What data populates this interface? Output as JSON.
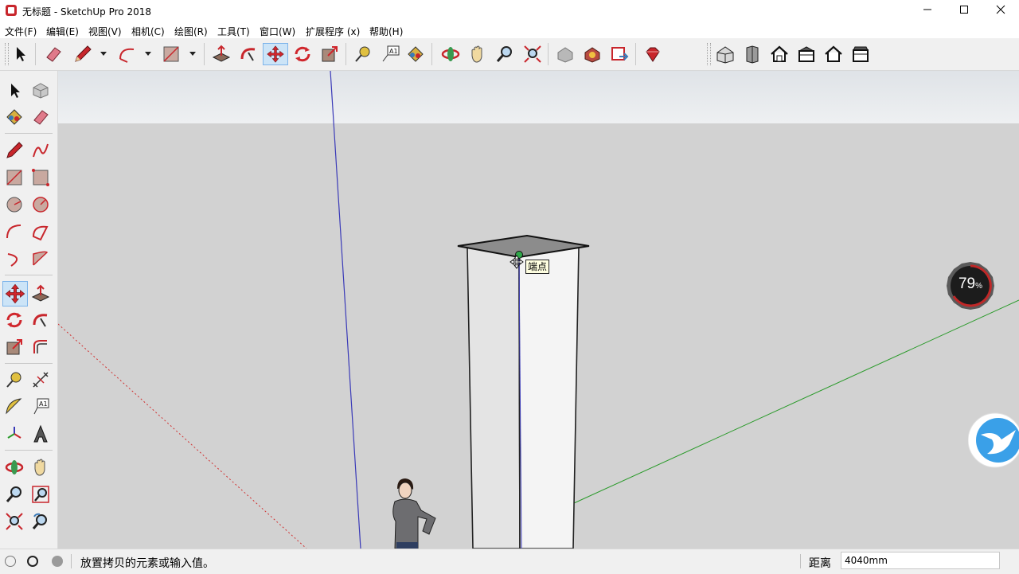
{
  "window": {
    "title": "无标题 - SketchUp Pro 2018",
    "controls": [
      "minimize-icon",
      "maximize-icon",
      "close-icon"
    ]
  },
  "menu": [
    "文件(F)",
    "编辑(E)",
    "视图(V)",
    "相机(C)",
    "绘图(R)",
    "工具(T)",
    "窗口(W)",
    "扩展程序 (x)",
    "帮助(H)"
  ],
  "toolbar": {
    "icons": [
      "select-icon",
      "eraser-icon",
      "pencil-icon",
      "arc-icon",
      "rectangle-icon",
      "push-pull-icon",
      "follow-me-icon",
      "move-icon",
      "rotate-icon",
      "scale-icon",
      "tape-measure-icon",
      "text-icon",
      "paint-bucket-icon",
      "orbit-icon",
      "pan-icon",
      "zoom-icon",
      "zoom-extents-icon",
      "warehouse-icon",
      "extension-warehouse-icon",
      "send-to-layout-icon",
      "ruby-console-icon",
      "iso-view-icon",
      "front-view-icon",
      "home-view-icon",
      "right-view-icon",
      "back-view-icon",
      "bottom-view-icon"
    ],
    "active": "move-icon"
  },
  "left_toolbar": {
    "icons": [
      "select-icon",
      "make-component-icon",
      "paint-bucket-icon",
      "eraser-icon",
      "pencil-icon",
      "freehand-icon",
      "rectangle-icon",
      "rotated-rectangle-icon",
      "circle-icon",
      "polygon-icon",
      "arc-icon",
      "pie-icon",
      "three-point-arc-icon",
      "two-point-arc-icon",
      "move-icon",
      "push-pull-icon",
      "rotate-icon",
      "follow-me-icon",
      "scale-icon",
      "offset-icon",
      "tape-measure-icon",
      "dimension-icon",
      "protractor-icon",
      "text-icon",
      "axes-icon",
      "3d-text-icon",
      "orbit-icon",
      "pan-icon",
      "zoom-icon",
      "zoom-window-icon",
      "zoom-extents-icon",
      "previous-view-icon"
    ],
    "active": "move-icon"
  },
  "viewport": {
    "tooltip": "端点",
    "gauge": {
      "value": "79",
      "unit": "%"
    }
  },
  "status": {
    "message": "放置拷贝的元素或输入值。",
    "measurement_label": "距离",
    "measurement_value": "4040mm"
  },
  "colors": {
    "viewport_bg": "#d2d2d2",
    "blue_axis": "#3a3ab8",
    "green_axis": "#2a9a2a",
    "red_axis": "#d03030",
    "active_tool": "#cce4f7"
  }
}
